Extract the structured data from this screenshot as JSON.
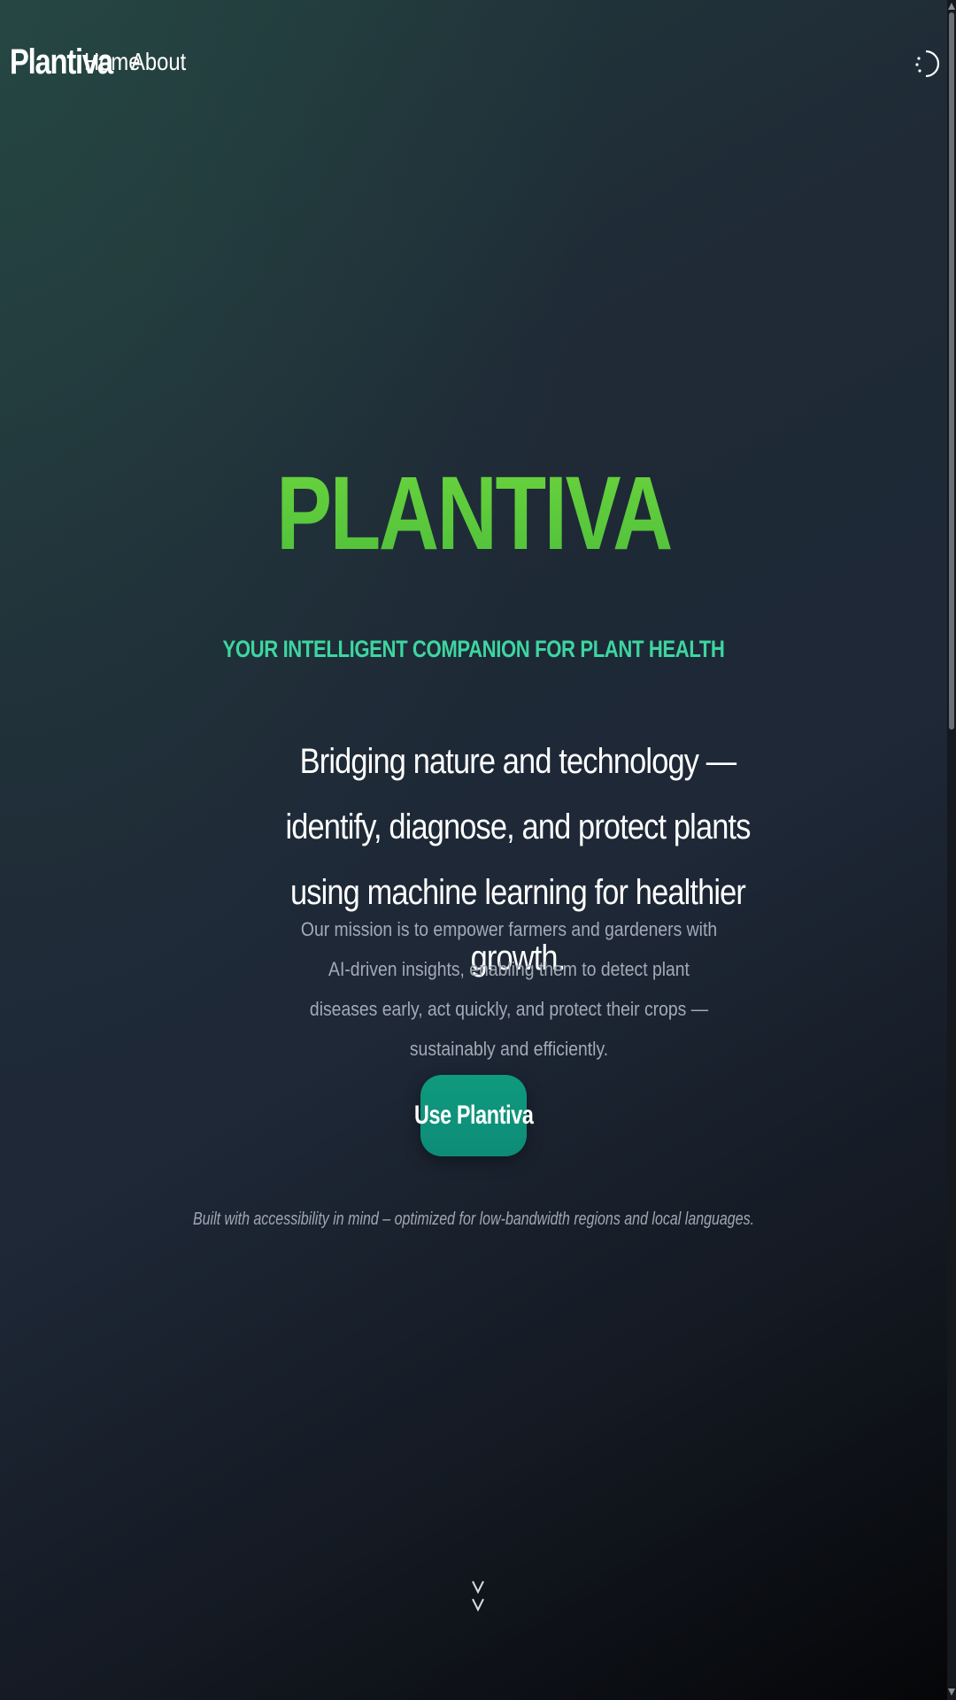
{
  "nav": {
    "brand": "Plantiva",
    "links": [
      {
        "label": "Home"
      },
      {
        "label": "About"
      }
    ],
    "theme_toggle_icon": "moon-sun-icon"
  },
  "hero": {
    "title": "PLANTIVA",
    "tagline": "YOUR INTELLIGENT COMPANION FOR PLANT HEALTH",
    "lead": "Bridging nature and technology — identify, diagnose, and protect plants using machine learning for healthier growth.",
    "mission": "Our mission is to empower farmers and gardeners with AI-driven insights, enabling them to detect plant diseases early, act quickly, and protect their crops — sustainably and efficiently.",
    "cta_label": "Use Plantiva",
    "note": "Built with accessibility in mind – optimized for low-bandwidth regions and local languages.",
    "scroll_icon": "double-chevron-down-icon"
  },
  "colors": {
    "title_green": "#5ccc3d",
    "tagline_teal": "#3dd6a0",
    "cta_bg": "#0f9a7d",
    "background_dark": "#1e2837"
  }
}
